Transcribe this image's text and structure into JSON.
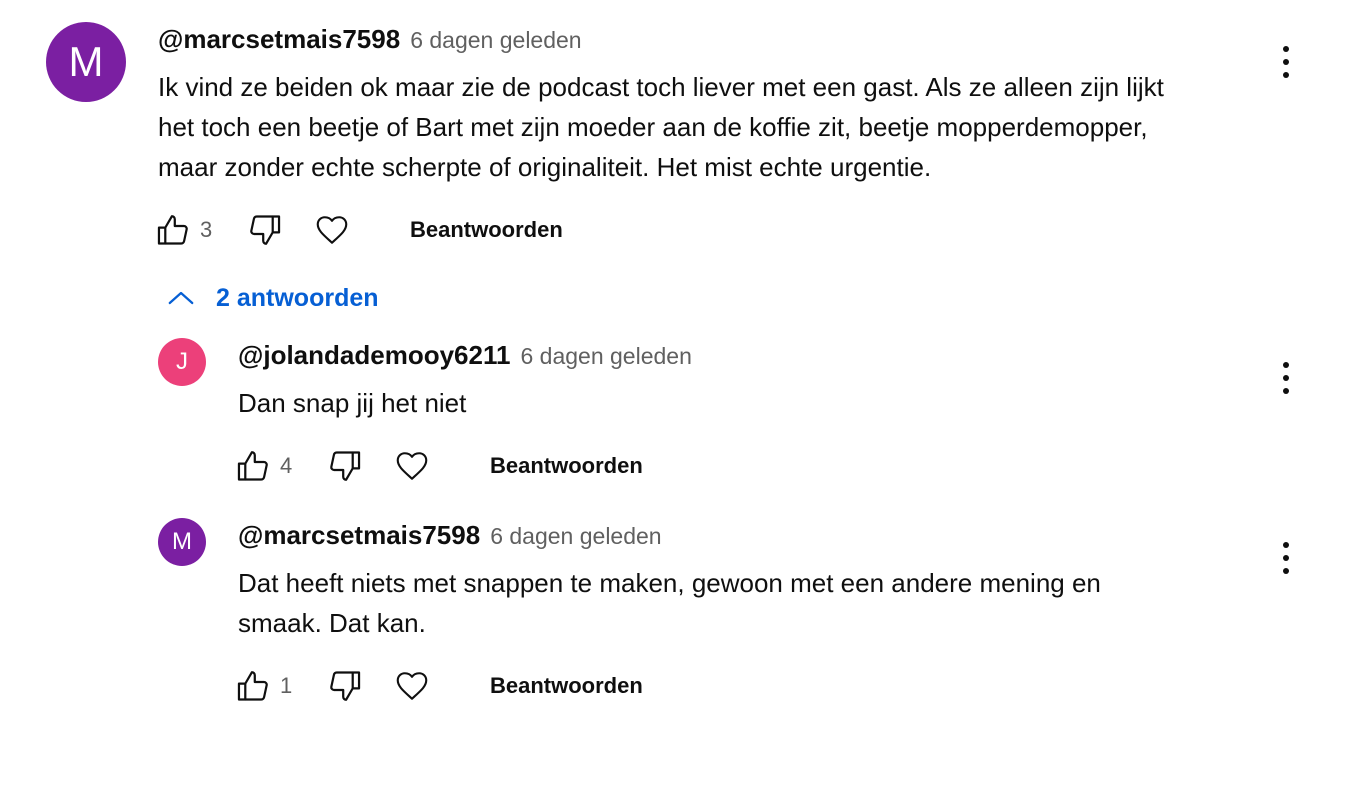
{
  "comment": {
    "avatar_letter": "M",
    "avatar_color": "#7b1fa2",
    "author": "@marcsetmais7598",
    "time": "6 dagen geleden",
    "lines": [
      "Ik vind ze beiden ok maar zie de podcast toch liever met een gast. Als ze alleen zijn lijkt",
      "het toch een beetje of Bart met zijn moeder aan de koffie zit, beetje mopperdemopper,",
      "maar zonder echte scherpte of originaliteit. Het mist echte urgentie."
    ],
    "likes": "3",
    "reply_label": "Beantwoorden"
  },
  "replies_toggle": {
    "label": "2 antwoorden",
    "color": "#065fd4"
  },
  "replies": [
    {
      "avatar_letter": "J",
      "avatar_color": "#ec407a",
      "author": "@jolandademooy6211",
      "time": "6 dagen geleden",
      "lines": [
        "Dan snap jij het niet"
      ],
      "likes": "4",
      "reply_label": "Beantwoorden"
    },
    {
      "avatar_letter": "M",
      "avatar_color": "#7b1fa2",
      "author": "@marcsetmais7598",
      "time": "6 dagen geleden",
      "lines": [
        "Dat heeft niets met snappen te maken, gewoon met een andere mening en",
        "smaak. Dat kan."
      ],
      "likes": "1",
      "reply_label": "Beantwoorden"
    }
  ],
  "icons": {
    "like": "thumbs-up-icon",
    "dislike": "thumbs-down-icon",
    "heart": "heart-icon",
    "menu": "more-vert-icon",
    "chevron": "chevron-up-icon"
  }
}
